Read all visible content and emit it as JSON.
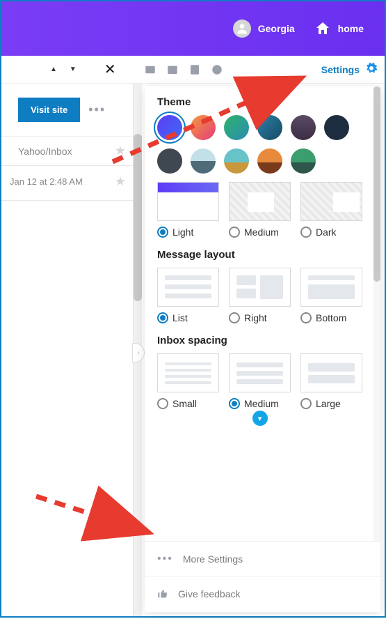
{
  "header": {
    "user": "Georgia",
    "home": "home"
  },
  "toolbar": {
    "settings_label": "Settings"
  },
  "left": {
    "visit_site": "Visit site",
    "inbox_label": "Yahoo/Inbox",
    "time_label": "Jan 12 at 2:48 AM"
  },
  "panel": {
    "theme": {
      "title": "Theme",
      "opts": [
        "Light",
        "Medium",
        "Dark"
      ],
      "selected": "Light"
    },
    "layout": {
      "title": "Message layout",
      "opts": [
        "List",
        "Right",
        "Bottom"
      ],
      "selected": "List"
    },
    "spacing": {
      "title": "Inbox spacing",
      "opts": [
        "Small",
        "Medium",
        "Large"
      ],
      "selected": "Medium"
    },
    "footer": {
      "more": "More Settings",
      "feedback": "Give feedback"
    }
  }
}
